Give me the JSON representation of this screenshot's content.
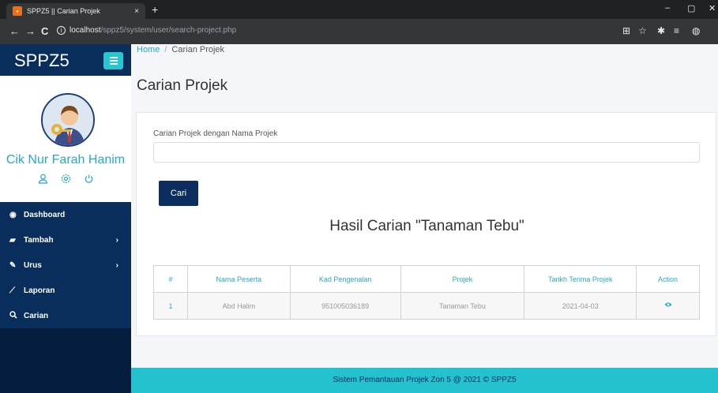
{
  "browser": {
    "tab_title": "SPPZ5 || Carian Projek",
    "tab_close": "×",
    "new_tab": "+",
    "url_host": "localhost",
    "url_path": "/sppz5/system/user/search-project.php",
    "back": "←",
    "forward": "→",
    "reload": "C",
    "minimize": "–",
    "maximize": "▢",
    "close": "✕"
  },
  "sidebar": {
    "brand": "SPPZ5",
    "user_name": "Cik Nur Farah Hanim",
    "items": [
      {
        "label": "Dashboard",
        "icon": "dashboard-icon",
        "glyph": "◉",
        "has_children": false
      },
      {
        "label": "Tambah",
        "icon": "book-icon",
        "glyph": "▰",
        "has_children": true
      },
      {
        "label": "Urus",
        "icon": "edit-icon",
        "glyph": "✎",
        "has_children": true
      },
      {
        "label": "Laporan",
        "icon": "chart-line-icon",
        "glyph": "⟋",
        "has_children": false
      },
      {
        "label": "Carian",
        "icon": "search-icon",
        "glyph": "🔍︎",
        "has_children": false
      }
    ]
  },
  "breadcrumb": {
    "home": "Home",
    "separator": "/",
    "current": "Carian Projek"
  },
  "page_title": "Carian Projek",
  "search": {
    "label": "Carian Projek dengan Nama Projek",
    "value": "",
    "button": "Cari"
  },
  "results": {
    "title": "Hasil Carian \"Tanaman Tebu\"",
    "columns": [
      "#",
      "Nama Peserta",
      "Kad Pengenalan",
      "Projek",
      "Tarikh Terima Projek",
      "Action"
    ],
    "rows": [
      [
        "1",
        "Abd Halim",
        "951005036189",
        "Tanaman Tebu",
        "2021-04-03",
        "view"
      ]
    ]
  },
  "footer": "Sistem Pemantauan Projek Zon 5 @ 2021 © SPPZ5",
  "colors": {
    "sidebar": "#0a2e5c",
    "accent": "#27a9c7",
    "footer": "#24c2cf"
  }
}
